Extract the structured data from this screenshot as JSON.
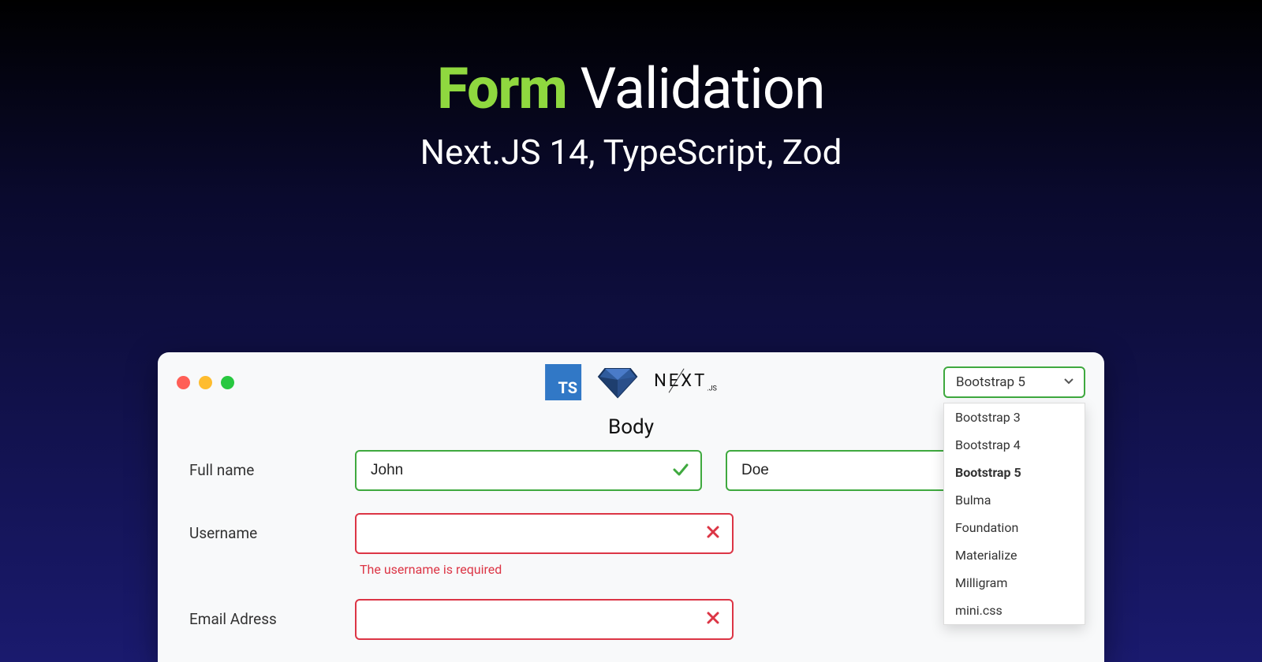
{
  "title": {
    "highlight": "Form",
    "rest": "Validation"
  },
  "subtitle": "Next.JS 14, TypeScript, Zod",
  "window": {
    "logos": {
      "ts": "TS",
      "next": "NEXT",
      "next_sub": ".JS"
    },
    "framework_select": {
      "selected": "Bootstrap 5",
      "options": [
        "Bootstrap 3",
        "Bootstrap 4",
        "Bootstrap 5",
        "Bulma",
        "Foundation",
        "Materialize",
        "Milligram",
        "mini.css"
      ]
    },
    "section_label": "Body",
    "form": {
      "fullname": {
        "label": "Full name",
        "first": "John",
        "last": "Doe"
      },
      "username": {
        "label": "Username",
        "value": "",
        "error": "The username is required"
      },
      "email": {
        "label": "Email Adress",
        "value": ""
      }
    }
  }
}
